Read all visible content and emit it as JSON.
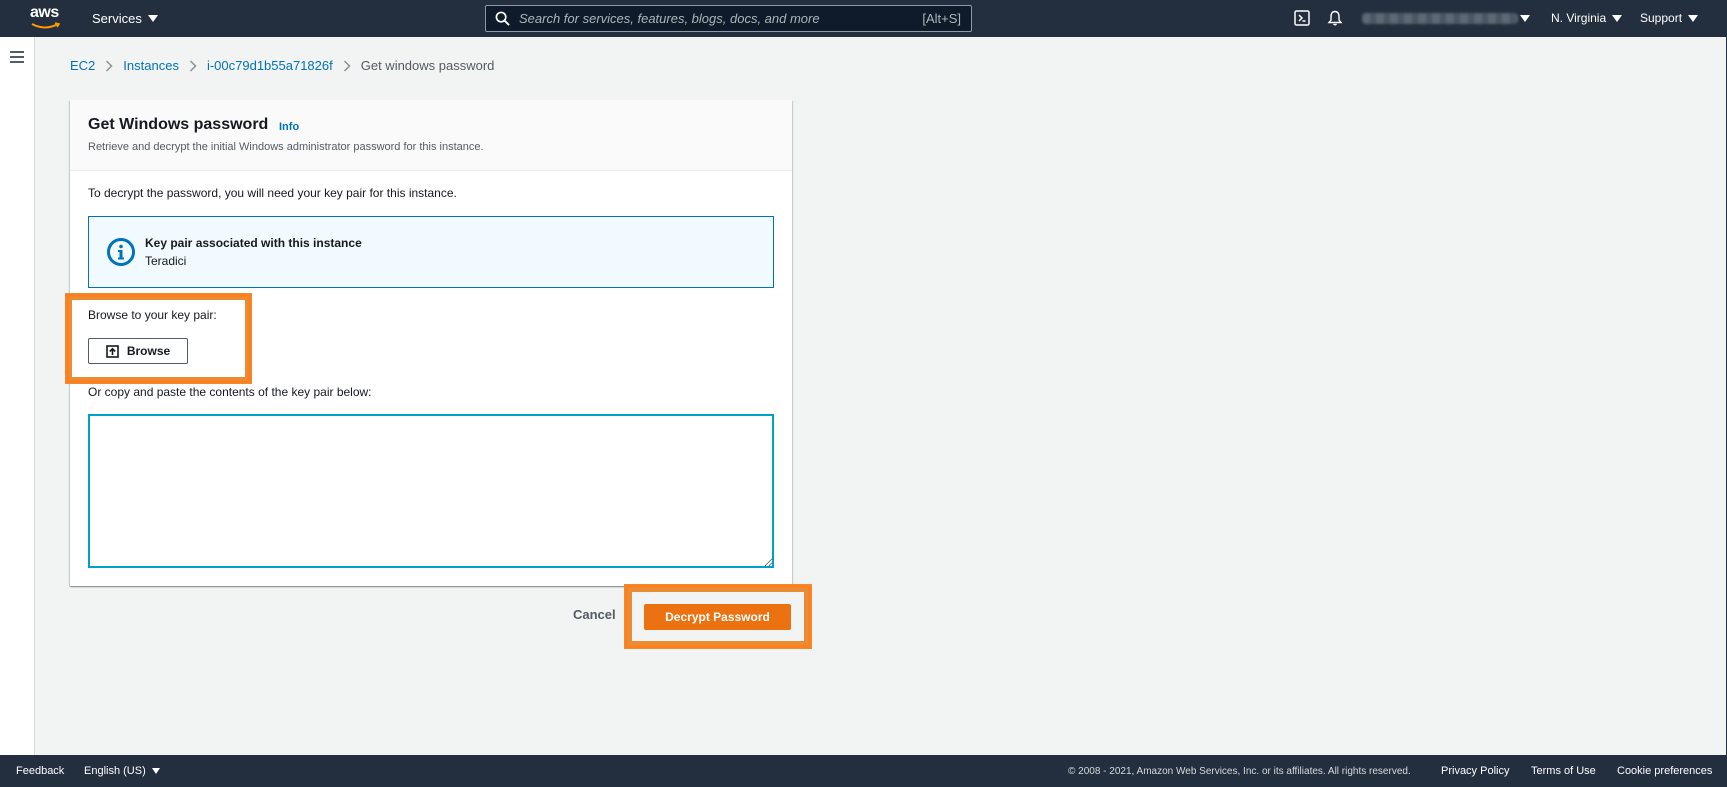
{
  "topnav": {
    "logo_text": "aws",
    "services_label": "Services",
    "search_placeholder": "Search for services, features, blogs, docs, and more",
    "search_shortcut": "[Alt+S]",
    "region_label": "N. Virginia",
    "support_label": "Support"
  },
  "breadcrumb": {
    "items": [
      "EC2",
      "Instances",
      "i-00c79d1b55a71826f"
    ],
    "current": "Get windows password"
  },
  "card": {
    "title": "Get Windows password",
    "info_label": "Info",
    "description": "Retrieve and decrypt the initial Windows administrator password for this instance.",
    "intro": "To decrypt the password, you will need your key pair for this instance.",
    "alert_title": "Key pair associated with this instance",
    "alert_value": "Teradici",
    "browse_label": "Browse to your key pair:",
    "browse_button": "Browse",
    "paste_label": "Or copy and paste the contents of the key pair below:",
    "keypair_value": ""
  },
  "actions": {
    "cancel": "Cancel",
    "decrypt": "Decrypt Password"
  },
  "footer": {
    "feedback": "Feedback",
    "language": "English (US)",
    "copyright": "© 2008 - 2021, Amazon Web Services, Inc. or its affiliates. All rights reserved.",
    "privacy": "Privacy Policy",
    "terms": "Terms of Use",
    "cookies": "Cookie preferences"
  },
  "colors": {
    "nav_bg": "#232f3e",
    "link": "#0073bb",
    "primary_button": "#ec7211",
    "highlight": "#ff7f1f"
  },
  "icons": [
    "search-icon",
    "cloudshell-icon",
    "bell-icon",
    "hamburger-icon",
    "info-circle-icon",
    "upload-icon"
  ]
}
